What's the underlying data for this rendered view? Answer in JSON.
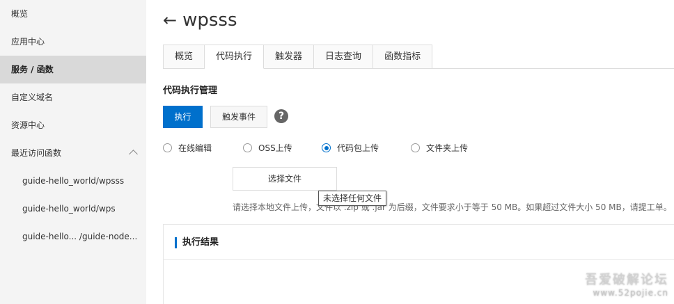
{
  "sidebar": {
    "items": [
      {
        "label": "概览"
      },
      {
        "label": "应用中心"
      },
      {
        "label": "服务 / 函数"
      },
      {
        "label": "自定义域名"
      },
      {
        "label": "资源中心"
      },
      {
        "label": "最近访问函数"
      }
    ],
    "recent": [
      {
        "label": "guide-hello_world/wpsss"
      },
      {
        "label": "guide-hello_world/wps"
      },
      {
        "label": "guide-hello... /guide-node..."
      }
    ]
  },
  "header": {
    "back_glyph": "←",
    "title": "wpsss"
  },
  "tabs": [
    {
      "label": "概览"
    },
    {
      "label": "代码执行"
    },
    {
      "label": "触发器"
    },
    {
      "label": "日志查询"
    },
    {
      "label": "函数指标"
    }
  ],
  "code_section": {
    "title": "代码执行管理",
    "execute_label": "执行",
    "trigger_event_label": "触发事件",
    "help_glyph": "?",
    "radios": [
      {
        "label": "在线编辑",
        "checked": false
      },
      {
        "label": "OSS上传",
        "checked": false
      },
      {
        "label": "代码包上传",
        "checked": true
      },
      {
        "label": "文件夹上传",
        "checked": false
      }
    ],
    "choose_file_label": "选择文件",
    "tooltip": "未选择任何文件",
    "hint": "请选择本地文件上传，文件以 .zip 或 .jar 为后缀，文件要求小于等于 50 MB。如果超过文件大小 50 MB，请提工单。"
  },
  "result": {
    "title": "执行结果"
  },
  "watermark": {
    "line1": "吾爱破解论坛",
    "line2": "www.52pojie.cn"
  },
  "colors": {
    "primary": "#0070cc",
    "sidebar_bg": "#f4f4f4",
    "sidebar_active": "#d9d9d9"
  }
}
